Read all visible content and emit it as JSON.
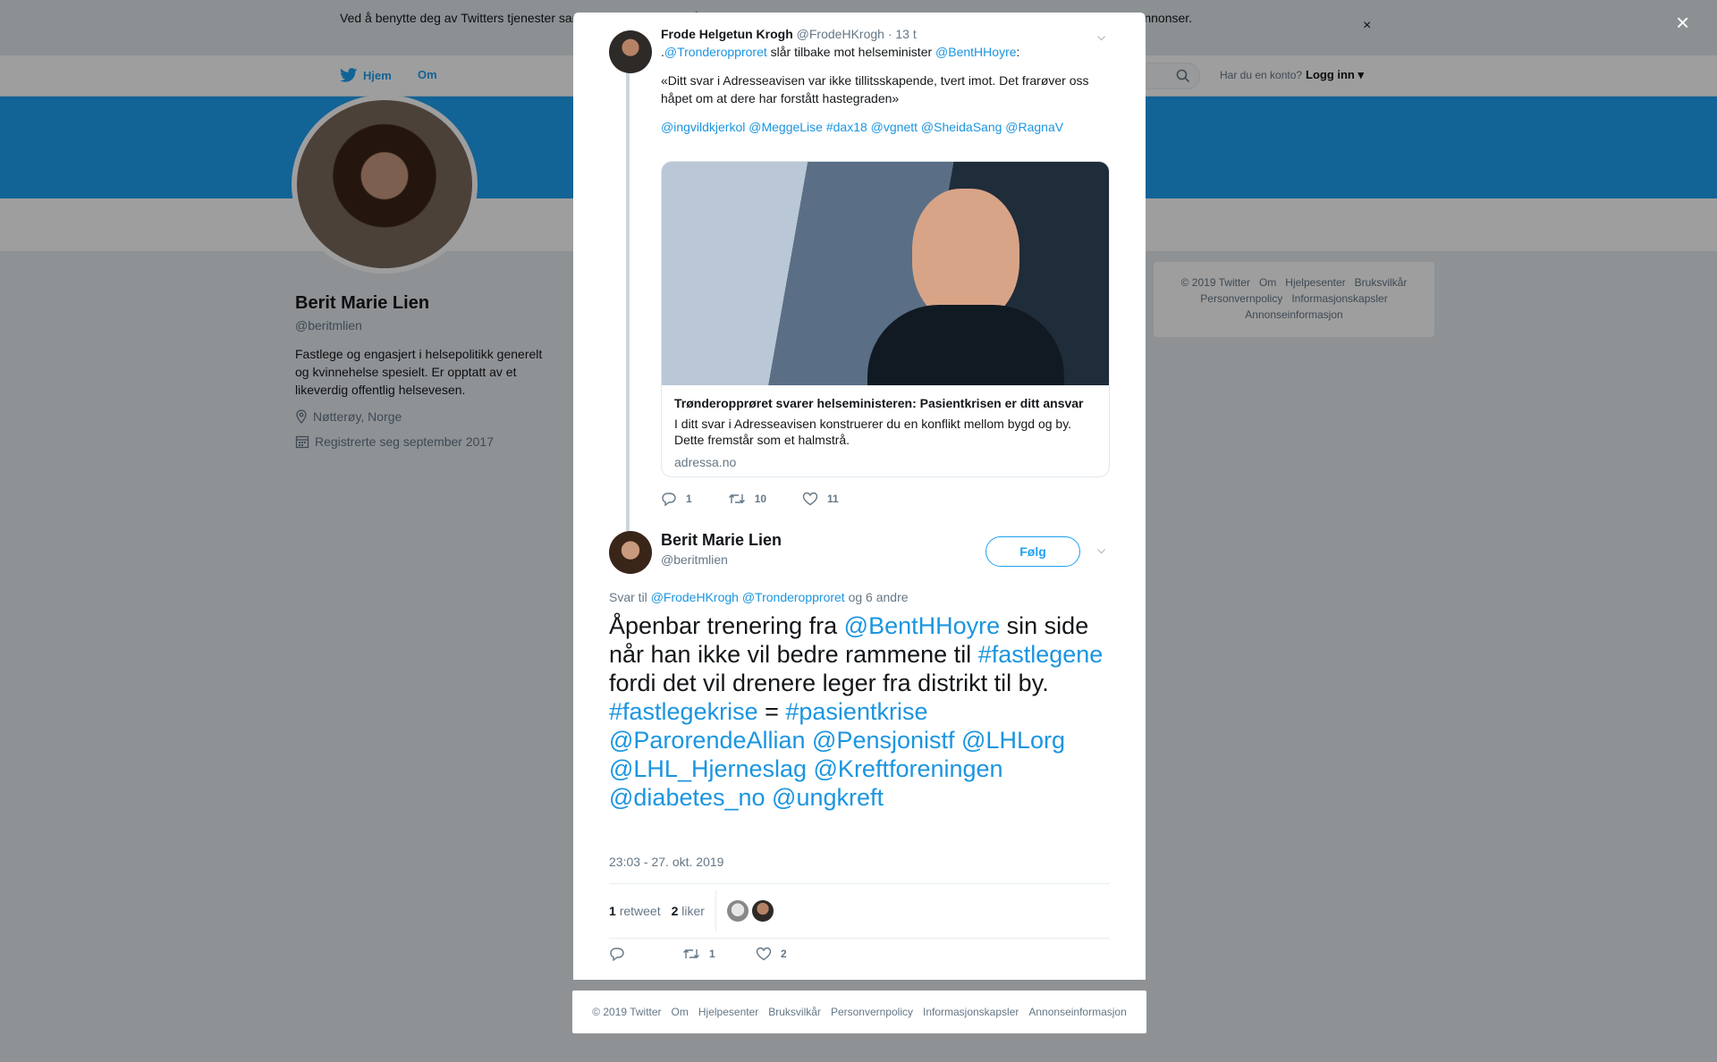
{
  "cookie_bar": {
    "text": "Ved å benytte deg av Twitters tjenester samtykker du i at vi og våre partnere kan bruke informasjonskapsler til bl.a. analyser, personalisering og annonser.",
    "close": "×"
  },
  "nav": {
    "home": "Hjem",
    "about": "Om",
    "account_prompt": "Har du en konto?",
    "login": "Logg inn"
  },
  "profile": {
    "name": "Berit Marie Lien",
    "handle": "@beritmlien",
    "bio": "Fastlege og engasjert i helsepolitikk generelt og kvinnehelse spesielt. Er opptatt av et likeverdig offentlig helsevesen.",
    "location": "Nøtterøy, Norge",
    "joined": "Registrerte seg september 2017"
  },
  "side_footer": {
    "items": [
      "© 2019 Twitter",
      "Om",
      "Hjelpesenter",
      "Bruksvilkår",
      "Personvernpolicy",
      "Informasjonskapsler",
      "Annonseinformasjon"
    ]
  },
  "overlay": {
    "close": "×"
  },
  "parent_tweet": {
    "name": "Frode Helgetun Krogh",
    "handle": "@FrodeHKrogh",
    "time": "· 13 t",
    "line1_prefix": ".",
    "mention1": "@Tronderopproret",
    "line1_mid": " slår tilbake mot helseminister ",
    "mention2": "@BentHHoyre",
    "line1_suffix": ":",
    "quote": "«Ditt svar i Adresseavisen var ikke tillitsskapende, tvert imot. Det frarøver oss håpet om at dere har forstått hastegraden»",
    "tags": "@ingvildkjerkol @MeggeLise #dax18 @vgnett @SheidaSang @RagnaV",
    "card": {
      "title": "Trønderopprøret svarer helseministeren: Pasientkrisen er ditt ansvar",
      "description": "I ditt svar i Adresseavisen konstruerer du en konflikt mellom bygd og by. Dette fremstår som et halmstrå.",
      "domain": "adressa.no"
    },
    "replies": "1",
    "retweets": "10",
    "likes": "11"
  },
  "main_tweet": {
    "name": "Berit Marie Lien",
    "handle": "@beritmlien",
    "follow": "Følg",
    "reply_prefix": "Svar til ",
    "reply_user1": "@FrodeHKrogh",
    "reply_user2": "@Tronderopproret",
    "reply_suffix": " og 6 andre",
    "text_1": "Åpenbar trenering fra ",
    "mention_1": "@BentHHoyre",
    "text_2": " sin side når han ikke vil bedre rammene til ",
    "hashtag_1": "#fastlegene",
    "text_3": " fordi det vil drenere leger fra distrikt til by.",
    "hashtag_2": "#fastlegekrise",
    "text_4": " = ",
    "hashtag_3": "#pasientkrise",
    "mentions_tail": "@ParorendeAllian @Pensjonistf @LHLorg @LHL_Hjerneslag @Kreftforeningen @diabetes_no @ungkreft",
    "date": "23:03 - 27. okt. 2019",
    "retweet_count": "1",
    "retweet_label": "retweet",
    "like_count": "2",
    "like_label": "liker",
    "action_retweets": "1",
    "action_likes": "2"
  },
  "bottom_footer": {
    "items": [
      "© 2019 Twitter",
      "Om",
      "Hjelpesenter",
      "Bruksvilkår",
      "Personvernpolicy",
      "Informasjonskapsler",
      "Annonseinformasjon"
    ]
  },
  "icons": {
    "twitter_bird": "twitter-bird-icon",
    "search": "search-icon",
    "location": "location-pin-icon",
    "calendar": "calendar-icon",
    "reply": "reply-icon",
    "retweet": "retweet-icon",
    "like": "heart-icon",
    "caret": "chevron-down-icon"
  },
  "colors": {
    "brand": "#1da1f2",
    "link": "#1b95e0",
    "muted": "#657786"
  }
}
